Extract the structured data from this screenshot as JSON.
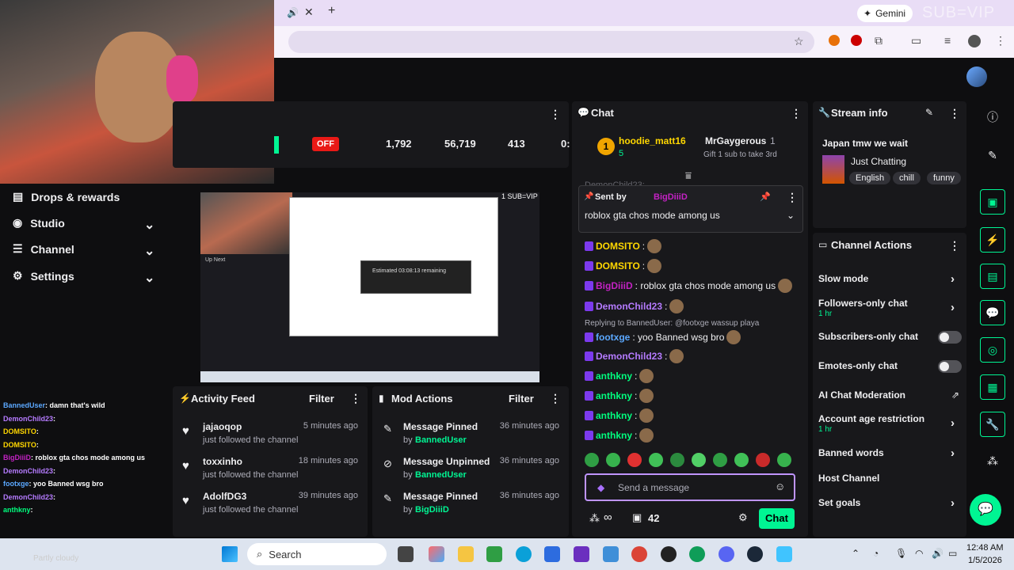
{
  "browser": {
    "gemini_label": "Gemini",
    "watermark": "SUB=VIP"
  },
  "stats": {
    "status": "OFF",
    "viewers": "1,792",
    "followers": "56,719",
    "subs": "413",
    "partial": "0:"
  },
  "sidebar": {
    "items": [
      {
        "label": "Drops & rewards"
      },
      {
        "label": "Studio"
      },
      {
        "label": "Channel"
      },
      {
        "label": "Settings"
      }
    ]
  },
  "player": {
    "watermark": "1 SUB=VIP",
    "dialog": "Estimated 03:08:13 remaining",
    "up_next": "Up Next"
  },
  "chat": {
    "title": "Chat",
    "hype": {
      "rank": "1",
      "user": "hoodie_matt16",
      "count": "5",
      "gifter": "MrGaygerous",
      "gifter_count": "1",
      "gift_note": "Gift 1 sub to take 3rd"
    },
    "pinned": {
      "sent_by": "Sent by",
      "user": "BigDiiiD",
      "message": "roblox gta chos mode among us",
      "ghost": "DemonChild23:"
    },
    "messages": [
      {
        "user": "DOMSITO",
        "color": "#ffd700",
        "text": ":"
      },
      {
        "user": "DOMSITO",
        "color": "#ffd700",
        "text": ":"
      },
      {
        "user": "BigDiiiD",
        "color": "#c322c3",
        "text": ": roblox gta chos mode among us"
      },
      {
        "user": "DemonChild23",
        "color": "#b57bff",
        "text": ":"
      },
      {
        "reply": "Replying to BannedUser: @footxge wassup playa"
      },
      {
        "user": "footxge",
        "color": "#5ba8ff",
        "text": ": yoo Banned wsg bro"
      },
      {
        "user": "DemonChild23",
        "color": "#b57bff",
        "text": ":"
      },
      {
        "user": "anthkny",
        "color": "#00ff7f",
        "text": ":"
      },
      {
        "user": "anthkny",
        "color": "#00ff7f",
        "text": ":"
      },
      {
        "user": "anthkny",
        "color": "#00ff7f",
        "text": ":"
      },
      {
        "user": "anthkny",
        "color": "#00ff7f",
        "text": ":"
      }
    ],
    "input_placeholder": "Send a message",
    "points": "42",
    "chat_button": "Chat"
  },
  "stream_info": {
    "title": "Stream info",
    "stream_title": "Japan tmw we wait",
    "category": "Just Chatting",
    "tags": [
      "English",
      "chill",
      "funny"
    ]
  },
  "channel_actions": {
    "title": "Channel Actions",
    "items": [
      {
        "label": "Slow mode"
      },
      {
        "label": "Followers-only chat",
        "sub": "1 hr"
      },
      {
        "label": "Subscribers-only chat"
      },
      {
        "label": "Emotes-only chat"
      },
      {
        "label": "AI Chat Moderation"
      },
      {
        "label": "Account age restriction",
        "sub": "1 hr"
      },
      {
        "label": "Banned words"
      },
      {
        "label": "Host Channel"
      },
      {
        "label": "Set goals"
      }
    ]
  },
  "activity": {
    "title": "Activity Feed",
    "filter": "Filter",
    "rows": [
      {
        "user": "jajaoqop",
        "action": "just followed the channel",
        "time": "5 minutes ago"
      },
      {
        "user": "toxxinho",
        "action": "just followed the channel",
        "time": "18 minutes ago"
      },
      {
        "user": "AdolfDG3",
        "action": "just followed the channel",
        "time": "39 minutes ago"
      }
    ]
  },
  "mod": {
    "title": "Mod Actions",
    "filter": "Filter",
    "rows": [
      {
        "action": "Message Pinned",
        "by": "by",
        "user": "BannedUser",
        "time": "36 minutes ago"
      },
      {
        "action": "Message Unpinned",
        "by": "by",
        "user": "BannedUser",
        "time": "36 minutes ago"
      },
      {
        "action": "Message Pinned",
        "by": "by",
        "user": "BigDiiiD",
        "time": "36 minutes ago"
      }
    ]
  },
  "overlay_chat": [
    {
      "user": "BannedUser",
      "color": "#5ba8ff",
      "text": ": damn that's wild"
    },
    {
      "user": "DemonChild23",
      "color": "#b57bff",
      "text": ":"
    },
    {
      "user": "DOMSITO",
      "color": "#ffd700",
      "text": ":"
    },
    {
      "user": "DOMSITO",
      "color": "#ffd700",
      "text": ":"
    },
    {
      "user": "BigDiiiD",
      "color": "#c322c3",
      "text": ": roblox gta chos mode among us"
    },
    {
      "user": "DemonChild23",
      "color": "#b57bff",
      "text": ":"
    },
    {
      "user": "footxge",
      "color": "#5ba8ff",
      "text": ": yoo Banned wsg bro"
    },
    {
      "user": "DemonChild23",
      "color": "#b57bff",
      "text": ":"
    },
    {
      "user": "anthkny",
      "color": "#00ff7f",
      "text": ":"
    }
  ],
  "taskbar": {
    "search": "Search",
    "time": "12:48 AM",
    "date": "1/5/2026",
    "weather": "Partly cloudy"
  },
  "colors": {
    "accent": "#00f593",
    "off": "#e91916",
    "bg": "#0e0e10",
    "panel": "#18181b"
  }
}
